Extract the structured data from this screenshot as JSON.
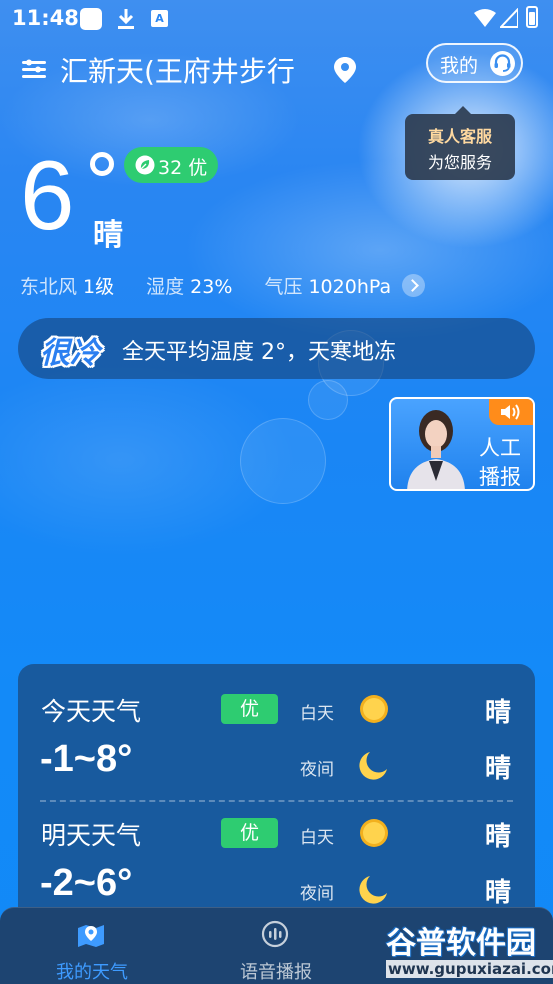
{
  "status_bar": {
    "time": "11:48",
    "font_glyph": "A"
  },
  "header": {
    "location": "汇新天(王府井步行",
    "mine_label": "我的"
  },
  "tooltip": {
    "line1": "真人客服",
    "line2": "为您服务"
  },
  "current": {
    "temperature": "6",
    "condition": "晴",
    "aqi": "32 优",
    "details": [
      {
        "label": "东北风",
        "value": "1级"
      },
      {
        "label": "湿度",
        "value": "23%"
      },
      {
        "label": "气压",
        "value": "1020hPa"
      }
    ]
  },
  "tip": {
    "tag": "很冷",
    "text": "全天平均温度 2°，天寒地冻"
  },
  "broadcast": {
    "line1": "人工",
    "line2": "播报"
  },
  "forecast": [
    {
      "title": "今天天气",
      "range": "-1~8°",
      "aqi": "优",
      "day_label": "白天",
      "day_condition": "晴",
      "night_label": "夜间",
      "night_condition": "晴"
    },
    {
      "title": "明天天气",
      "range": "-2~6°",
      "aqi": "优",
      "day_label": "白天",
      "day_condition": "晴",
      "night_label": "夜间",
      "night_condition": "晴"
    }
  ],
  "bottom_nav": [
    {
      "label": "我的天气",
      "active": true
    },
    {
      "label": "语音播报",
      "active": false
    }
  ],
  "watermark": {
    "title": "谷普软件园",
    "url": "www.gupuxiazai.com"
  },
  "colors": {
    "aqi_good": "#2ecc71",
    "active_nav": "#3e9bff",
    "card_bg": "#185a9e"
  }
}
